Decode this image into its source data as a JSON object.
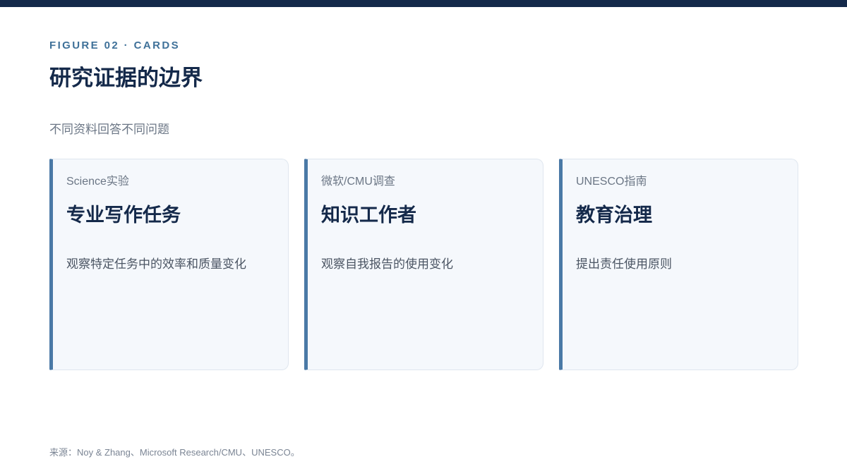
{
  "figure_label": "FIGURE 02 · CARDS",
  "title": "研究证据的边界",
  "subtitle": "不同资料回答不同问题",
  "cards": [
    {
      "source": "Science实验",
      "heading": "专业写作任务",
      "description": "观察特定任务中的效率和质量变化"
    },
    {
      "source": "微软/CMU调查",
      "heading": "知识工作者",
      "description": "观察自我报告的使用变化"
    },
    {
      "source": "UNESCO指南",
      "heading": "教育治理",
      "description": "提出责任使用原则"
    }
  ],
  "footnote": "来源：Noy & Zhang、Microsoft Research/CMU、UNESCO。",
  "colors": {
    "top_bar": "#14294a",
    "accent": "#4a79a6",
    "eyebrow": "#3f7199",
    "card_background": "#f5f8fc"
  }
}
